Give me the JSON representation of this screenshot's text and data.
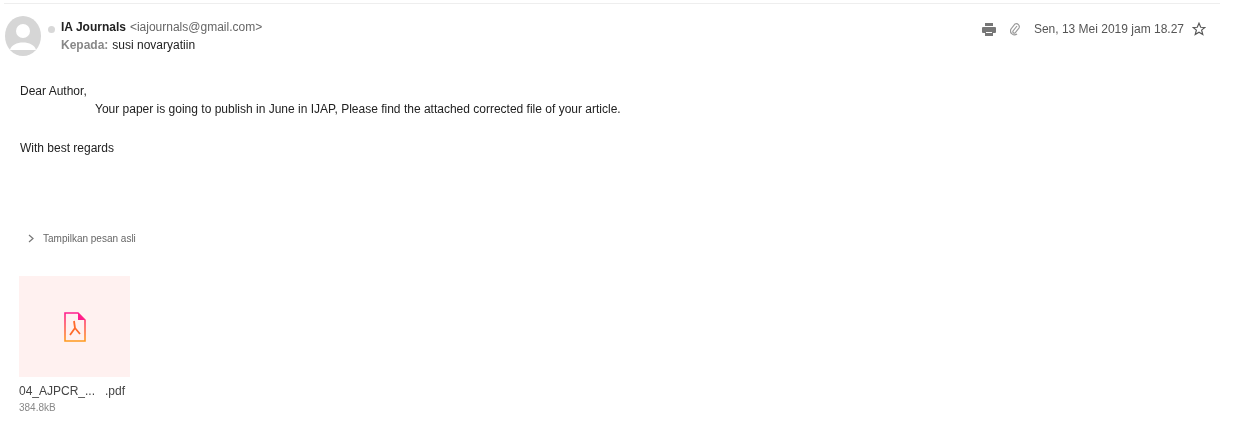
{
  "sender": {
    "name": "IA Journals",
    "email": "<iajournals@gmail.com>",
    "to_label": "Kepada:",
    "to": "susi novaryatiin"
  },
  "header": {
    "date": "Sen, 13 Mei 2019 jam 18.27",
    "starred": false
  },
  "body": {
    "greeting": "Dear Author,",
    "message": "Your paper is going to publish in June in IJAP, Please find the attached corrected file of your article.",
    "closing": "With best regards"
  },
  "show_original": {
    "label": "Tampilkan pesan asli",
    "expanded": false
  },
  "attachments": [
    {
      "name": "04_AJPCR_...   .pdf",
      "size": "384.8kB"
    }
  ]
}
